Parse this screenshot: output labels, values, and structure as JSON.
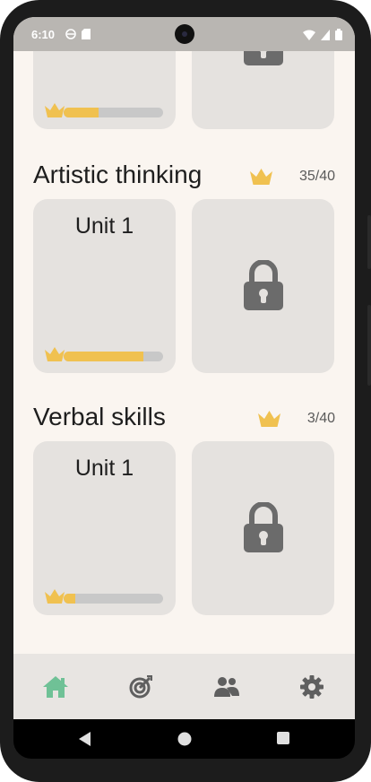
{
  "status_bar": {
    "time": "6:10",
    "icons_left": [
      "sync-icon",
      "sd-card-icon"
    ],
    "icons_right": [
      "wifi-icon",
      "signal-icon",
      "battery-icon"
    ]
  },
  "partial_section": {
    "card_left": {
      "progress": 0.35
    },
    "card_right": {
      "locked": true
    }
  },
  "sections": [
    {
      "title": "Artistic thinking",
      "score": "35/40",
      "units": [
        {
          "title": "Unit 1",
          "progress": 0.8,
          "locked": false
        },
        {
          "locked": true
        }
      ]
    },
    {
      "title": "Verbal skills",
      "score": "3/40",
      "units": [
        {
          "title": "Unit 1",
          "progress": 0.12,
          "locked": false
        },
        {
          "locked": true
        }
      ]
    }
  ],
  "bottom_nav": {
    "items": [
      "home-icon",
      "target-icon",
      "people-icon",
      "settings-icon"
    ],
    "active": "home-icon"
  },
  "colors": {
    "crown": "#f0c150",
    "progress_fill": "#f0c150",
    "active_nav": "#6fc196",
    "inactive_nav": "#5f5f5f",
    "lock": "#6b6b6b"
  }
}
